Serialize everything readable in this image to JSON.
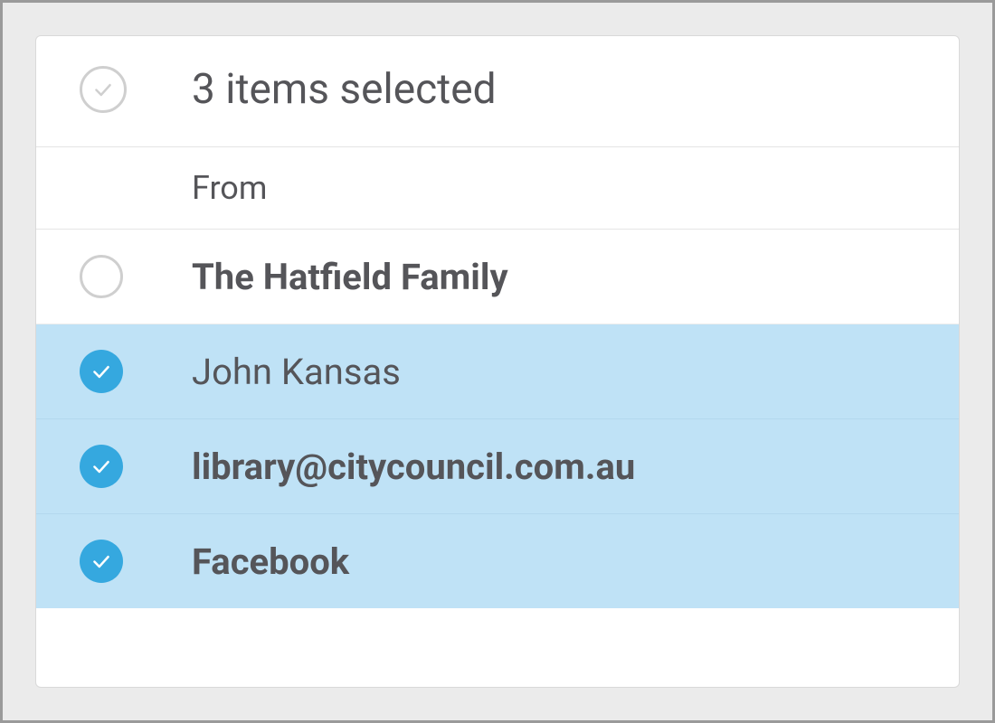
{
  "header": {
    "selection_summary": "3 items selected"
  },
  "columns": {
    "from_label": "From"
  },
  "rows": [
    {
      "from": "The Hatfield Family",
      "selected": false,
      "bold": true
    },
    {
      "from": "John Kansas",
      "selected": true,
      "bold": false
    },
    {
      "from": "library@citycouncil.com.au",
      "selected": true,
      "bold": true
    },
    {
      "from": "Facebook",
      "selected": true,
      "bold": true
    }
  ],
  "colors": {
    "accent": "#35a8df",
    "selected_bg": "#bfe2f6",
    "text": "#555559"
  }
}
